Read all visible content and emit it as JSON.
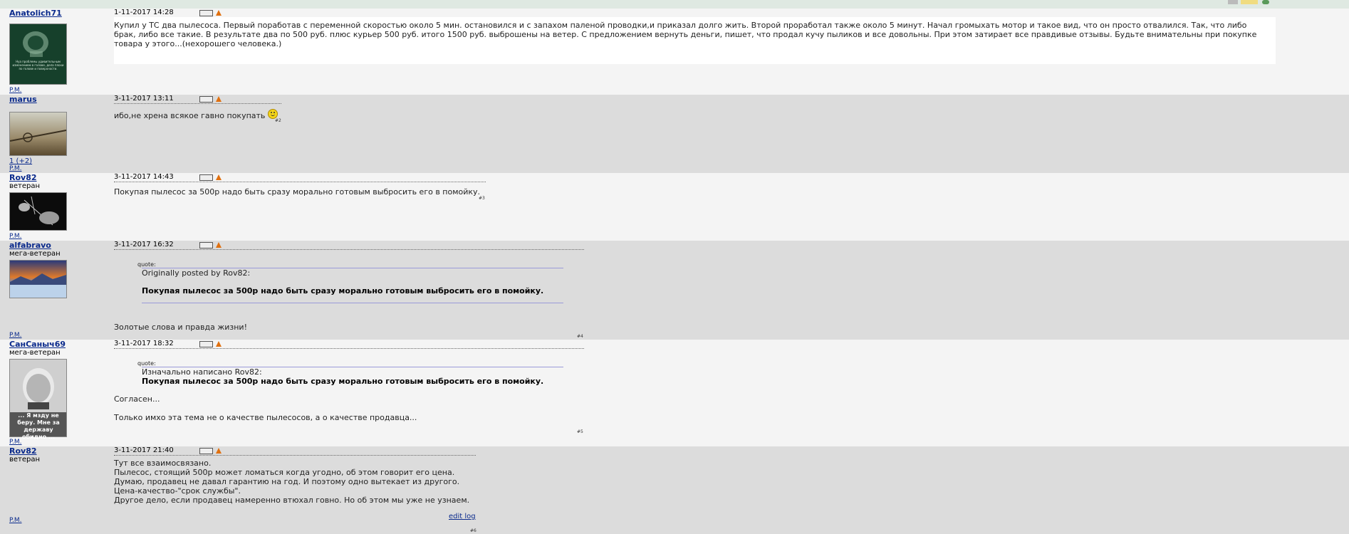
{
  "posts": [
    {
      "username": "Anatolich71",
      "rank": "",
      "date": "1-11-2017 14:28",
      "pm": "P.M.",
      "avatar_caption": "Нуа проблемы удивительным изменением в голове, дела плохи по голове и поверхности.",
      "message": "Купил у ТС два пылесоса. Первый поработав с переменной скоростью около 5 мин. остановился и с запахом паленой проводки,и приказал долго жить. Второй проработал также около 5 минут. Начал громыхать мотор и такое вид, что он просто отвалился. Так, что либо брак, либо все такие. В результате два по 500 руб. плюс курьер 500 руб. итого 1500 руб. выброшены на ветер. С предложением вернуть деньги, пишет, что продал кучу пыликов и все довольны. При этом затирает все правдивые отзывы. Будьте внимательны при покупке товара у этого...(нехорошего человека.)"
    },
    {
      "username": "marus",
      "rank": "",
      "date": "3-11-2017 13:11",
      "pm": "P.M.",
      "karma": "1 (+2)",
      "message": "ибо,не хрена всякое гавно покупать",
      "post_number": "#2"
    },
    {
      "username": "Rov82",
      "rank": "ветеран",
      "date": "3-11-2017 14:43",
      "pm": "P.M.",
      "message": "Покупая пылесос за 500р надо быть сразу морально готовым выбросить его в помойку.",
      "post_number": "#3"
    },
    {
      "username": "alfabravo",
      "rank": "мега-ветеран",
      "date": "3-11-2017 16:32",
      "pm": "P.M.",
      "quote_label": "quote:",
      "quote_author": "Originally posted by Rov82:",
      "quote_text": "Покупая пылесос за 500р надо быть сразу морально готовым выбросить его в помойку.",
      "message": "Золотые слова и правда жизни!",
      "post_number": "#4"
    },
    {
      "username": "СанСаныч69",
      "rank": "мега-ветеран",
      "date": "3-11-2017 18:32",
      "pm": "P.M.",
      "avatar_caption": "... Я мзду не беру. Мне за державу обидно ...",
      "quote_label": "quote:",
      "quote_author": "Изначально написано Rov82:",
      "quote_text": "Покупая пылесос за 500р надо быть сразу морально готовым выбросить его в помойку.",
      "message1": "Согласен...",
      "message2": "Только имхо эта тема не о качестве пылесосов, а о качестве продавца...",
      "post_number": "#5"
    },
    {
      "username": "Rov82",
      "rank": "ветеран",
      "date": "3-11-2017 21:40",
      "pm": "P.M.",
      "lines": [
        "Тут все взаимосвязано.",
        "Пылесос, стоящий 500р может ломаться когда угодно, об этом говорит его цена.",
        "Думаю, продавец не давал гарантию на год. И поэтому одно вытекает из другого.",
        "Цена-качество-\"срок службы\".",
        "Другое дело, если продавец намеренно втюхал говно. Но об этом мы уже не узнаем."
      ],
      "edit_log": "edit log",
      "post_number": "#6"
    }
  ],
  "colors": {
    "light_row": "#f4f4f4",
    "dark_row": "#dcdcdc",
    "link": "#0a2a8c",
    "accent_bar": "#dfe9e2"
  }
}
